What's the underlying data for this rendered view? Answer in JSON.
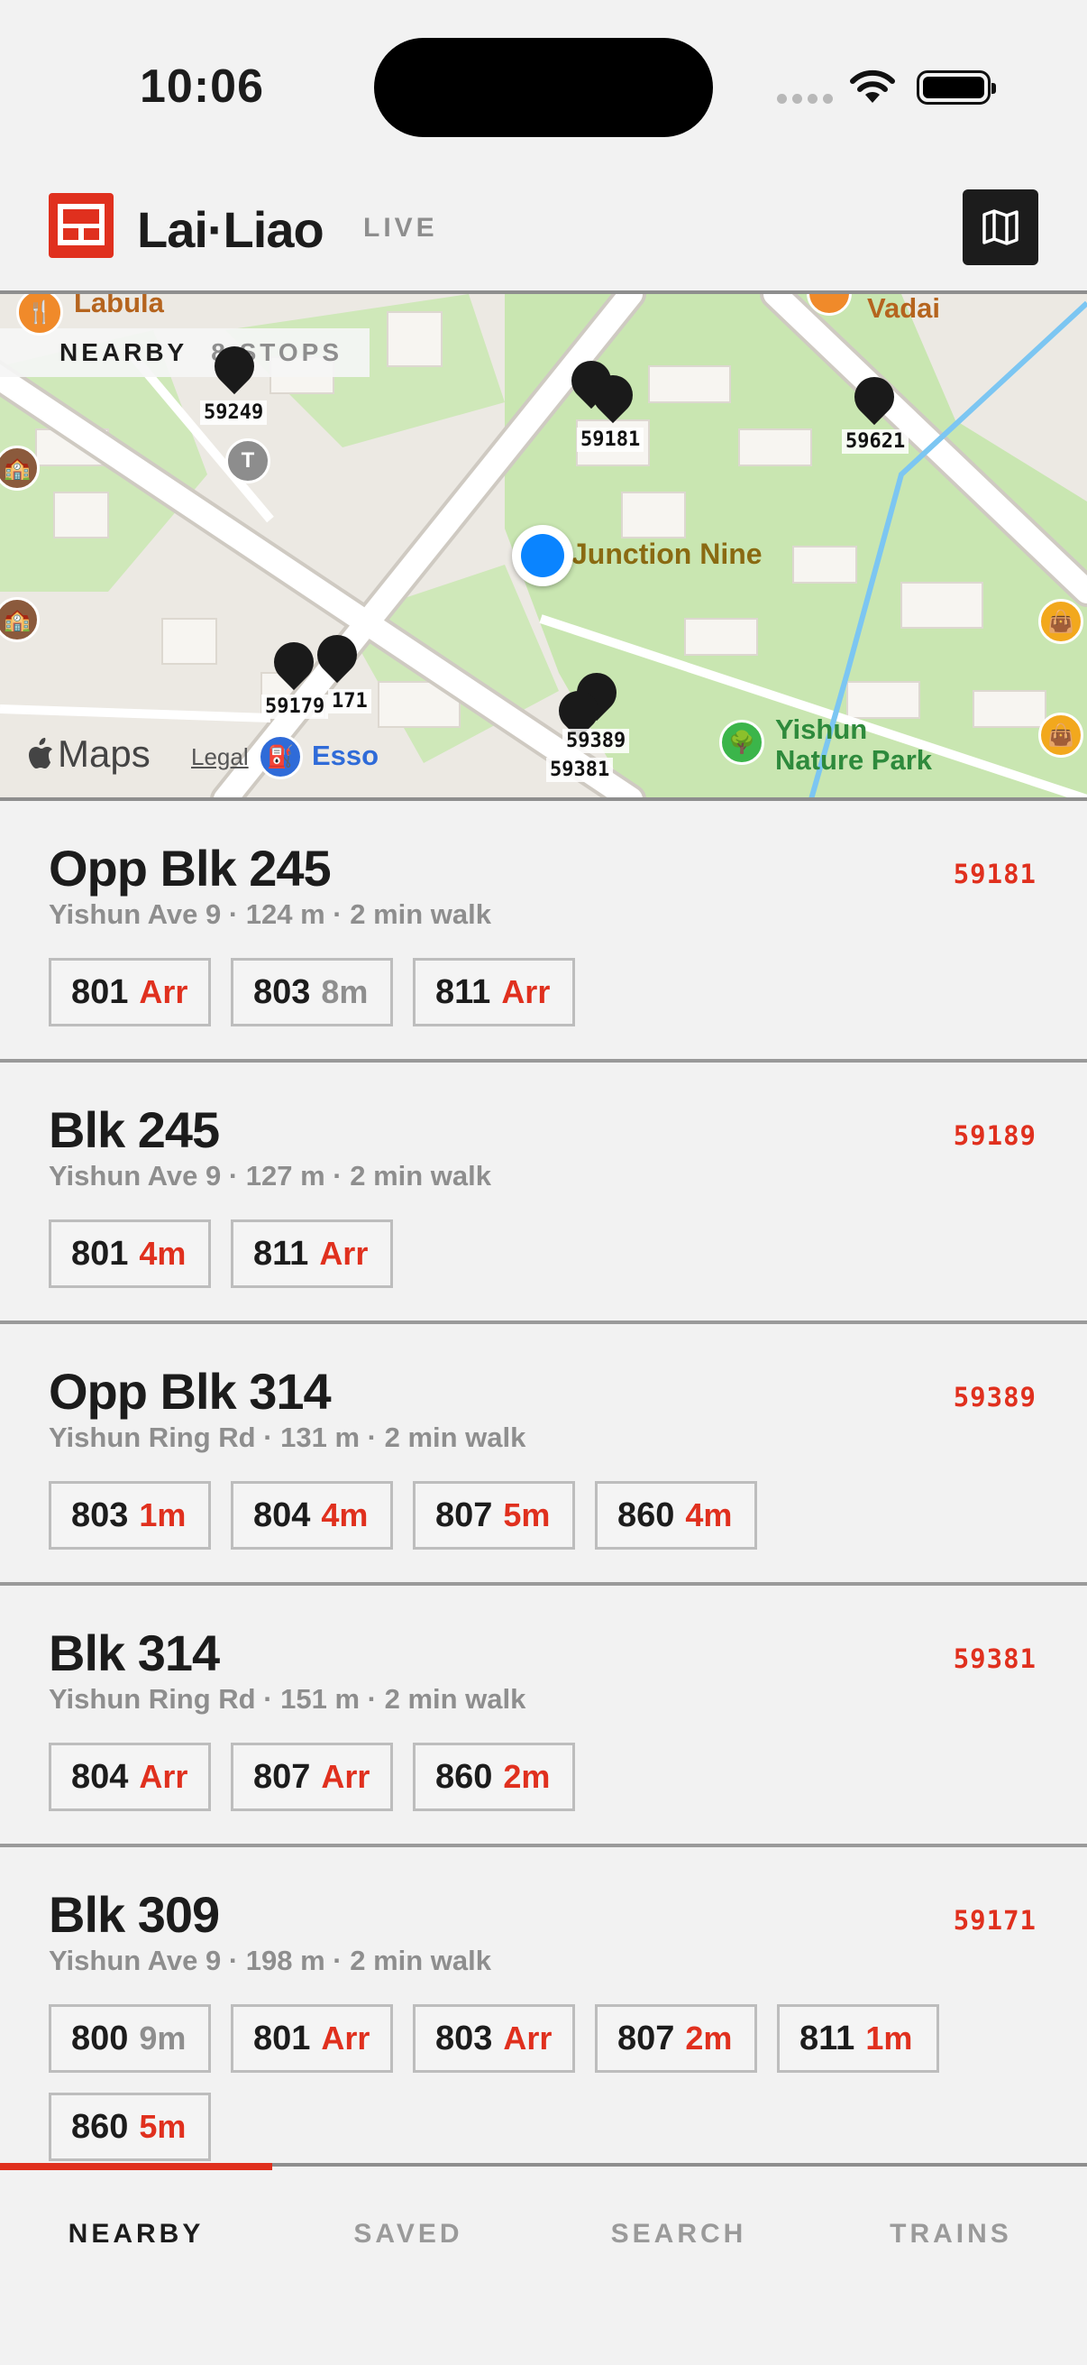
{
  "status_bar": {
    "time": "10:06"
  },
  "header": {
    "brand": "Lai·Liao",
    "live_label": "LIVE",
    "map_icon": "map-icon"
  },
  "map": {
    "nearby_label": "NEARBY",
    "stops_count": "8 STOPS",
    "poi": {
      "junction_nine": "Junction Nine",
      "vadai": "Vadai",
      "labula": "Labula",
      "yishun_park_line1": "Yishun",
      "yishun_park_line2": "Nature Park",
      "esso": "Esso"
    },
    "pins": [
      "59249",
      "59181",
      "59621",
      "59179",
      "171",
      "59389",
      "59381"
    ],
    "maps_label": "Maps",
    "legal_label": "Legal"
  },
  "stops": [
    {
      "name": "Opp Blk 245",
      "code": "59181",
      "meta": "Yishun Ave 9 · 124 m · 2 min walk",
      "services": [
        {
          "no": "801",
          "eta": "Arr",
          "grey": false
        },
        {
          "no": "803",
          "eta": "8m",
          "grey": true
        },
        {
          "no": "811",
          "eta": "Arr",
          "grey": false
        }
      ]
    },
    {
      "name": "Blk 245",
      "code": "59189",
      "meta": "Yishun Ave 9 · 127 m · 2 min walk",
      "services": [
        {
          "no": "801",
          "eta": "4m",
          "grey": false
        },
        {
          "no": "811",
          "eta": "Arr",
          "grey": false
        }
      ]
    },
    {
      "name": "Opp Blk 314",
      "code": "59389",
      "meta": "Yishun Ring Rd · 131 m · 2 min walk",
      "services": [
        {
          "no": "803",
          "eta": "1m",
          "grey": false
        },
        {
          "no": "804",
          "eta": "4m",
          "grey": false
        },
        {
          "no": "807",
          "eta": "5m",
          "grey": false
        },
        {
          "no": "860",
          "eta": "4m",
          "grey": false
        }
      ]
    },
    {
      "name": "Blk 314",
      "code": "59381",
      "meta": "Yishun Ring Rd · 151 m · 2 min walk",
      "services": [
        {
          "no": "804",
          "eta": "Arr",
          "grey": false
        },
        {
          "no": "807",
          "eta": "Arr",
          "grey": false
        },
        {
          "no": "860",
          "eta": "2m",
          "grey": false
        }
      ]
    },
    {
      "name": "Blk 309",
      "code": "59171",
      "meta": "Yishun Ave 9 · 198 m · 2 min walk",
      "services": [
        {
          "no": "800",
          "eta": "9m",
          "grey": true
        },
        {
          "no": "801",
          "eta": "Arr",
          "grey": false
        },
        {
          "no": "803",
          "eta": "Arr",
          "grey": false
        },
        {
          "no": "807",
          "eta": "2m",
          "grey": false
        },
        {
          "no": "811",
          "eta": "1m",
          "grey": false
        },
        {
          "no": "860",
          "eta": "5m",
          "grey": false
        }
      ]
    }
  ],
  "tabs": [
    {
      "label": "NEARBY",
      "active": true
    },
    {
      "label": "SAVED",
      "active": false
    },
    {
      "label": "SEARCH",
      "active": false
    },
    {
      "label": "TRAINS",
      "active": false
    }
  ],
  "colors": {
    "accent": "#e0301e",
    "text": "#1c1c1c",
    "muted": "#8e8e8e",
    "user_location": "#0a84ff"
  }
}
